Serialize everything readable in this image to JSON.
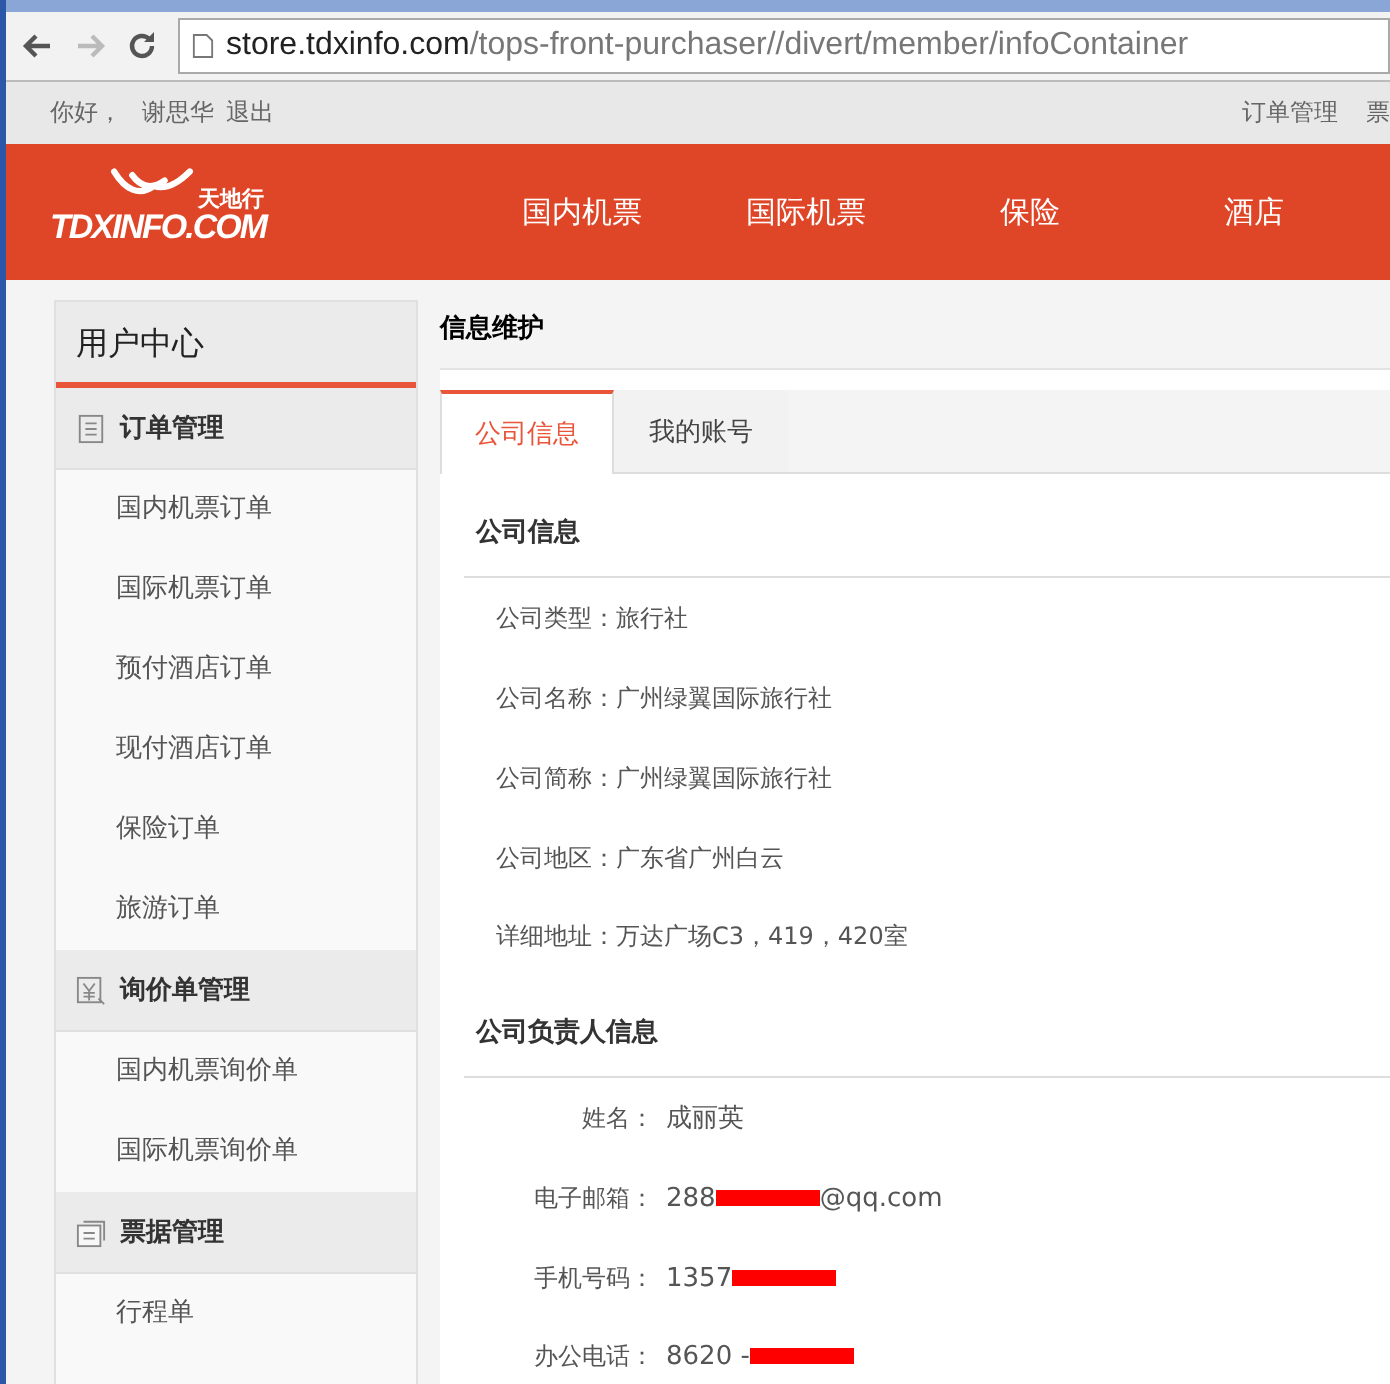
{
  "browser": {
    "url_host": "store.tdxinfo.com",
    "url_path": "/tops-front-purchaser//divert/member/infoContainer"
  },
  "top_bar": {
    "greeting": "你好，",
    "user": "谢思华",
    "logout": "退出",
    "links": [
      "订单管理",
      "票"
    ]
  },
  "header": {
    "logo_text": "TDXINFO.COM",
    "logo_cn": "天地行",
    "nav": [
      "国内机票",
      "国际机票",
      "保险",
      "酒店"
    ]
  },
  "sidebar": {
    "title": "用户中心",
    "groups": [
      {
        "label": "订单管理",
        "kind": "list",
        "items": [
          "国内机票订单",
          "国际机票订单",
          "预付酒店订单",
          "现付酒店订单",
          "保险订单",
          "旅游订单"
        ]
      },
      {
        "label": "询价单管理",
        "kind": "price",
        "items": [
          "国内机票询价单",
          "国际机票询价单"
        ]
      },
      {
        "label": "票据管理",
        "kind": "stack",
        "items": [
          "行程单"
        ]
      }
    ]
  },
  "main": {
    "title": "信息维护",
    "tabs": [
      {
        "label": "公司信息",
        "selected": true
      },
      {
        "label": "我的账号",
        "selected": false
      }
    ],
    "sections": [
      {
        "title": "公司信息",
        "kind": "plain",
        "fields": [
          {
            "label": "公司类型：",
            "value": "旅行社"
          },
          {
            "label": "公司名称：",
            "value": "广州绿翼国际旅行社"
          },
          {
            "label": "公司简称：",
            "value": "广州绿翼国际旅行社"
          },
          {
            "label": "公司地区：",
            "value": "广东省广州白云"
          },
          {
            "label": "详细地址：",
            "value": "万达广场C3，419，420室"
          }
        ]
      },
      {
        "title": "公司负责人信息",
        "kind": "person",
        "fields": [
          {
            "label": "姓名：",
            "value": "成丽英"
          },
          {
            "label": "电子邮箱：",
            "value": "288",
            "suffix": "@qq.com",
            "redacted": true
          },
          {
            "label": "手机号码：",
            "value": "1357",
            "redacted": true
          },
          {
            "label": "办公电话：",
            "value": "8620  -",
            "redacted": true
          }
        ]
      }
    ]
  }
}
